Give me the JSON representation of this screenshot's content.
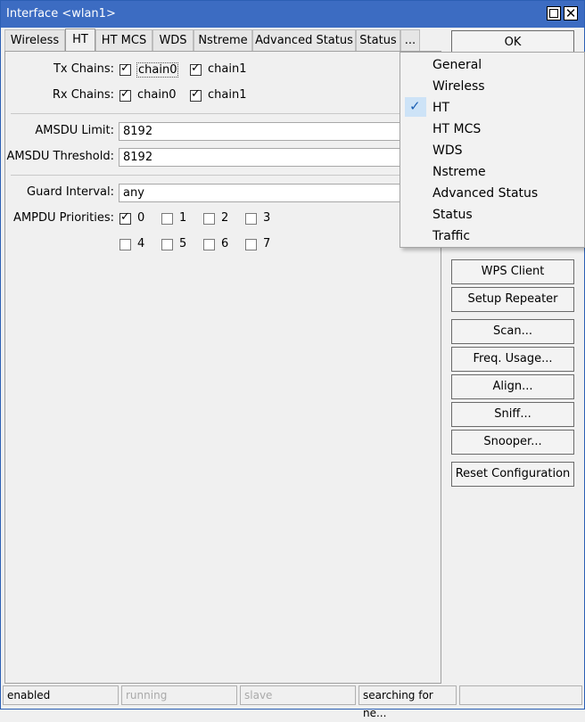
{
  "window": {
    "title": "Interface <wlan1>"
  },
  "tabs": [
    "Wireless",
    "HT",
    "HT MCS",
    "WDS",
    "Nstreme",
    "Advanced Status",
    "Status",
    "..."
  ],
  "active_tab": "HT",
  "form": {
    "tx_chains": {
      "label": "Tx Chains:",
      "options": [
        {
          "text": "chain0",
          "checked": true
        },
        {
          "text": "chain1",
          "checked": true
        }
      ]
    },
    "rx_chains": {
      "label": "Rx Chains:",
      "options": [
        {
          "text": "chain0",
          "checked": true
        },
        {
          "text": "chain1",
          "checked": true
        }
      ]
    },
    "amsdu_limit": {
      "label": "AMSDU Limit:",
      "value": "8192"
    },
    "amsdu_threshold": {
      "label": "AMSDU Threshold:",
      "value": "8192"
    },
    "guard_interval": {
      "label": "Guard Interval:",
      "value": "any"
    },
    "ampdu_priorities": {
      "label": "AMPDU Priorities:",
      "items": [
        {
          "text": "0",
          "checked": true
        },
        {
          "text": "1",
          "checked": false
        },
        {
          "text": "2",
          "checked": false
        },
        {
          "text": "3",
          "checked": false
        },
        {
          "text": "4",
          "checked": false
        },
        {
          "text": "5",
          "checked": false
        },
        {
          "text": "6",
          "checked": false
        },
        {
          "text": "7",
          "checked": false
        }
      ]
    }
  },
  "buttons": {
    "ok": "OK",
    "wps_client": "WPS Client",
    "setup_repeater": "Setup Repeater",
    "scan": "Scan...",
    "freq_usage": "Freq. Usage...",
    "align": "Align...",
    "sniff": "Sniff...",
    "snooper": "Snooper...",
    "reset_configuration": "Reset Configuration"
  },
  "dropdown_menu": {
    "items": [
      "General",
      "Wireless",
      "HT",
      "HT MCS",
      "WDS",
      "Nstreme",
      "Advanced Status",
      "Status",
      "Traffic"
    ],
    "checked": "HT"
  },
  "status_bar": {
    "state": "enabled",
    "running": "running",
    "slave": "slave",
    "status": "searching for ne..."
  },
  "icons": [
    "maximize-icon",
    "close-icon",
    "checkmark-icon"
  ]
}
